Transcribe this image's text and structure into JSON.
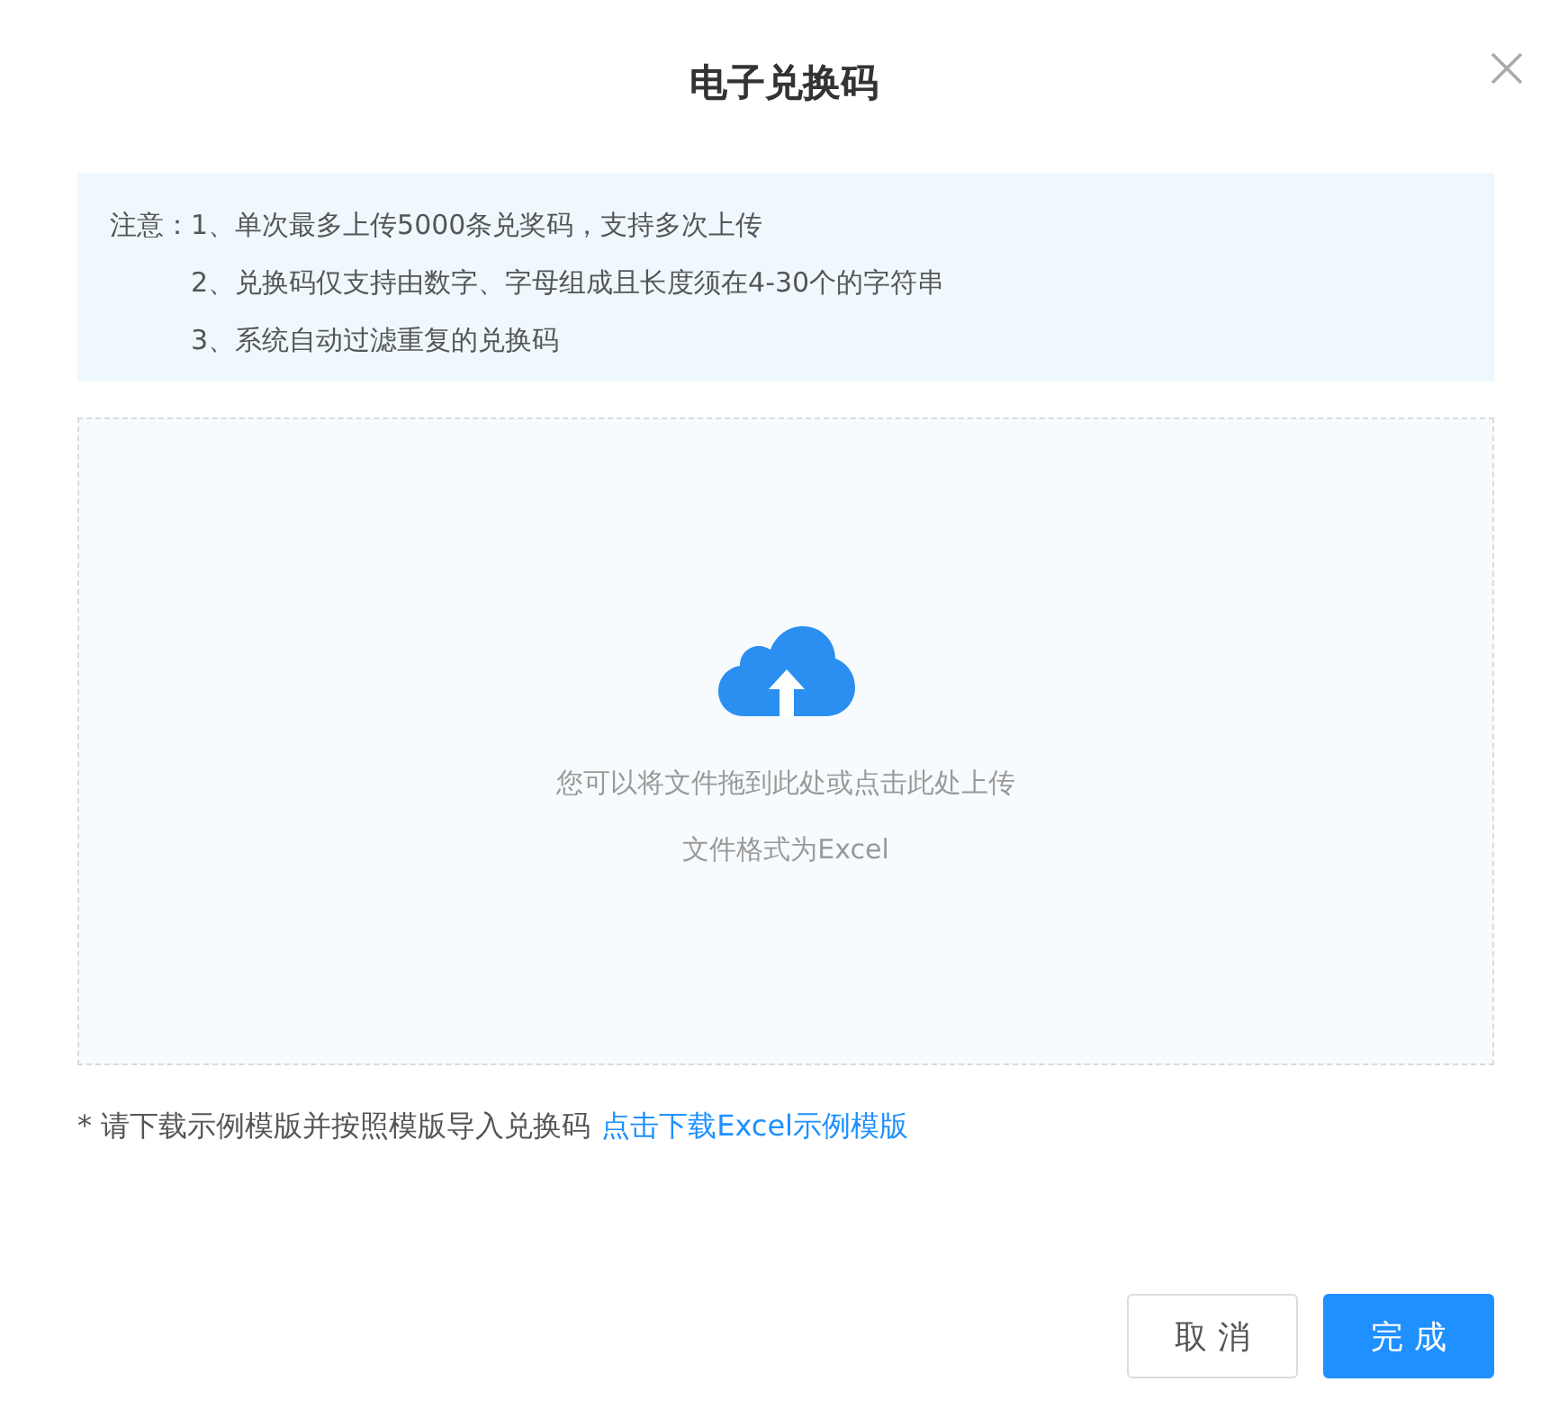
{
  "dialog": {
    "title": "电子兑换码"
  },
  "notice": {
    "label": "注意：",
    "items": [
      "1、单次最多上传5000条兑奖码，支持多次上传",
      "2、兑换码仅支持由数字、字母组成且长度须在4-30个的字符串",
      "3、系统自动过滤重复的兑换码"
    ]
  },
  "upload": {
    "hint": "您可以将文件拖到此处或点击此处上传",
    "format": "文件格式为Excel"
  },
  "template_note": {
    "text": "* 请下载示例模版并按照模版导入兑换码",
    "link": "点击下载Excel示例模版"
  },
  "buttons": [
    {
      "label": "取消",
      "kind": "secondary"
    },
    {
      "label": "完成",
      "kind": "primary"
    }
  ]
}
